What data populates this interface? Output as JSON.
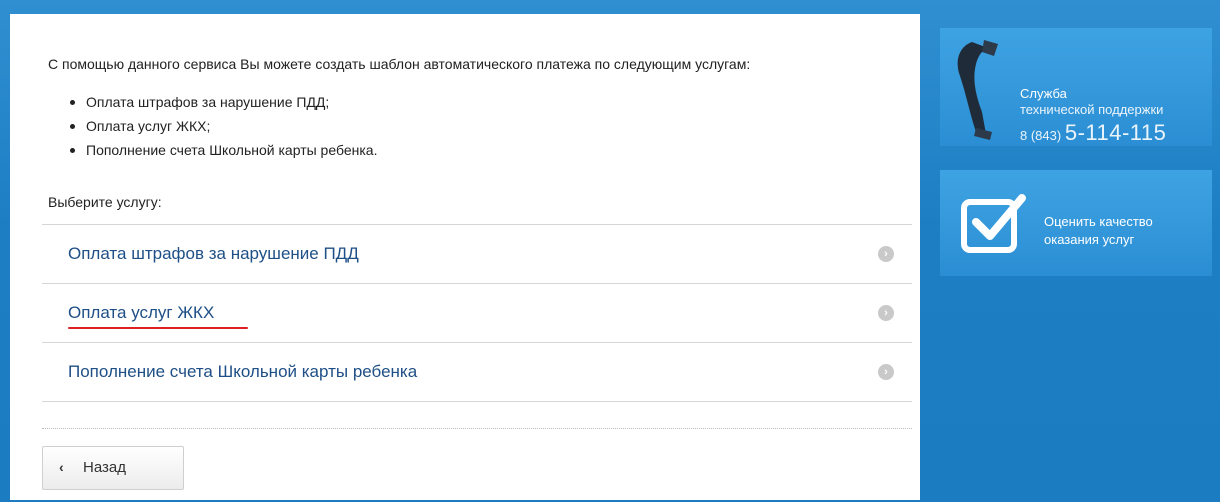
{
  "main": {
    "intro": "С помощью данного сервиса Вы можете создать шаблон автоматического платежа по следующим услугам:",
    "bullets": [
      "Оплата штрафов за нарушение ПДД;",
      "Оплата услуг ЖКХ;",
      "Пополнение счета Школьной карты ребенка."
    ],
    "choose_label": "Выберите услугу:",
    "services": [
      {
        "label": "Оплата штрафов за нарушение ПДД"
      },
      {
        "label": "Оплата услуг ЖКХ"
      },
      {
        "label": "Пополнение счета Школьной карты ребенка"
      }
    ],
    "back_label": "Назад"
  },
  "sidebar": {
    "support": {
      "line1": "Служба",
      "line2": "технической поддержки",
      "code": "8 (843)",
      "phone": "5-114-115"
    },
    "quality": {
      "line1": "Оценить качество",
      "line2": "оказания услуг"
    }
  },
  "colors": {
    "accent": "#1e4f86",
    "panel_blue": "#2b8ed4",
    "underline_red": "#e02020"
  }
}
